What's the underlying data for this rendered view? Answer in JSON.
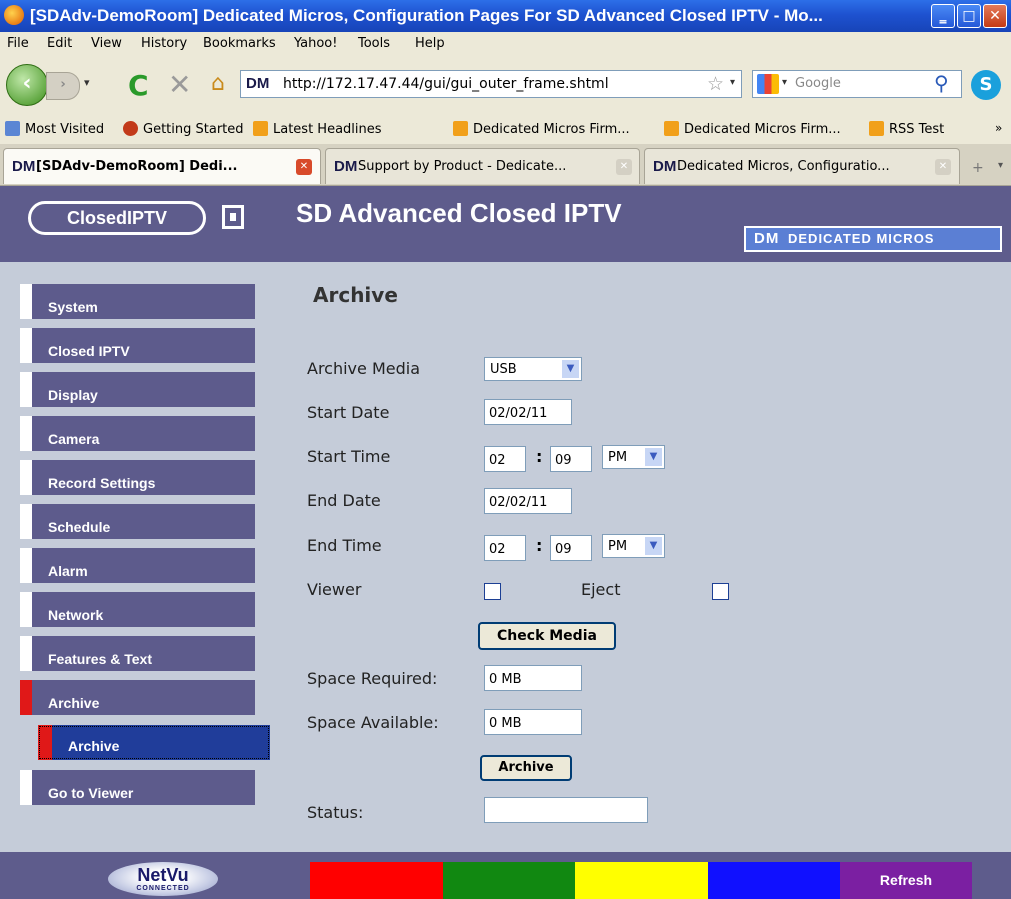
{
  "window": {
    "title": "[SDAdv-DemoRoom] Dedicated Micros, Configuration Pages For SD Advanced Closed IPTV - Mo...",
    "min": "‗",
    "max": "□",
    "close": "✕"
  },
  "menu": [
    "File",
    "Edit",
    "View",
    "History",
    "Bookmarks",
    "Yahoo!",
    "Tools",
    "Help"
  ],
  "nav": {
    "url": "http://172.17.47.44/gui/gui_outer_frame.shtml",
    "search_placeholder": "Google",
    "site_icon": "DM"
  },
  "bookmarks": [
    "Most Visited",
    "Getting Started",
    "Latest Headlines",
    "Dedicated Micros Firm...",
    "Dedicated Micros Firm...",
    "RSS Test"
  ],
  "tabs": [
    {
      "label": "[SDAdv-DemoRoom] Dedi...",
      "active": true
    },
    {
      "label": "Support by Product - Dedicate...",
      "active": false
    },
    {
      "label": "Dedicated Micros, Configuratio...",
      "active": false
    }
  ],
  "header": {
    "logo": "ClosedIPTV",
    "title": "SD Advanced Closed IPTV",
    "brand": "DEDICATED MICROS",
    "brand_icon": "DM"
  },
  "sidebar": {
    "items": [
      "System",
      "Closed IPTV",
      "Display",
      "Camera",
      "Record Settings",
      "Schedule",
      "Alarm",
      "Network",
      "Features & Text",
      "Archive"
    ],
    "sub": "Archive",
    "last": "Go to Viewer"
  },
  "form": {
    "title": "Archive",
    "archive_media_label": "Archive Media",
    "archive_media_value": "USB",
    "start_date_label": "Start Date",
    "start_date": "02/02/11",
    "start_time_label": "Start Time",
    "start_hour": "02",
    "start_min": "09",
    "start_ampm": "PM",
    "end_date_label": "End Date",
    "end_date": "02/02/11",
    "end_time_label": "End Time",
    "end_hour": "02",
    "end_min": "09",
    "end_ampm": "PM",
    "viewer_label": "Viewer",
    "eject_label": "Eject",
    "check_media": "Check Media",
    "space_required_label": "Space Required:",
    "space_required": "0 MB",
    "space_available_label": "Space Available:",
    "space_available": "0 MB",
    "archive_button": "Archive",
    "status_label": "Status:",
    "status_value": ""
  },
  "footer": {
    "logo": "NetVu",
    "logo_sub": "CONNECTED",
    "refresh": "Refresh",
    "colors": [
      "#ff0000",
      "#118811",
      "#ffff00",
      "#1010ff"
    ]
  }
}
